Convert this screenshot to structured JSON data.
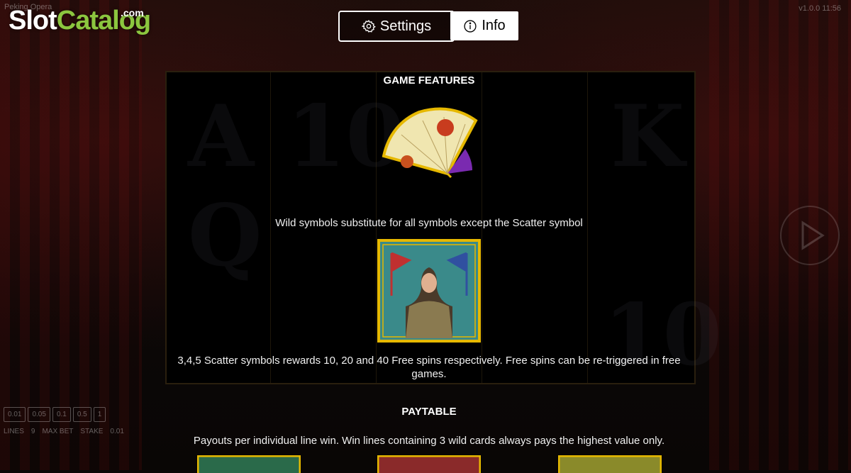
{
  "brand": {
    "part1": "Slot",
    "part2": "Catalog",
    "suffix": ".com"
  },
  "game_title": "Peking Opera",
  "top_right": "v1.0.0    11:56",
  "toolbar": {
    "settings_label": "Settings",
    "info_label": "Info",
    "settings_icon": "gear-icon",
    "info_icon": "info-icon"
  },
  "features": {
    "heading": "GAME FEATURES",
    "wild_text": "Wild symbols substitute for all symbols except the Scatter symbol",
    "scatter_text": "3,4,5 Scatter symbols rewards 10, 20 and 40 Free spins respectively. Free spins can be re-triggered in free games."
  },
  "paytable": {
    "heading": "PAYTABLE",
    "text": "Payouts per individual line win. Win lines containing 3 wild cards always pays the highest value only."
  },
  "bet_values": [
    "0.01",
    "0.05",
    "0.1",
    "0.5",
    "1"
  ],
  "bet_info": {
    "lines_label": "LINES",
    "lines_value": "9",
    "max_label": "MAX BET",
    "stake_label": "STAKE",
    "stake_value": "0.01"
  },
  "colors": {
    "logo_green": "#8cc63f",
    "gold": "#e6b800"
  }
}
